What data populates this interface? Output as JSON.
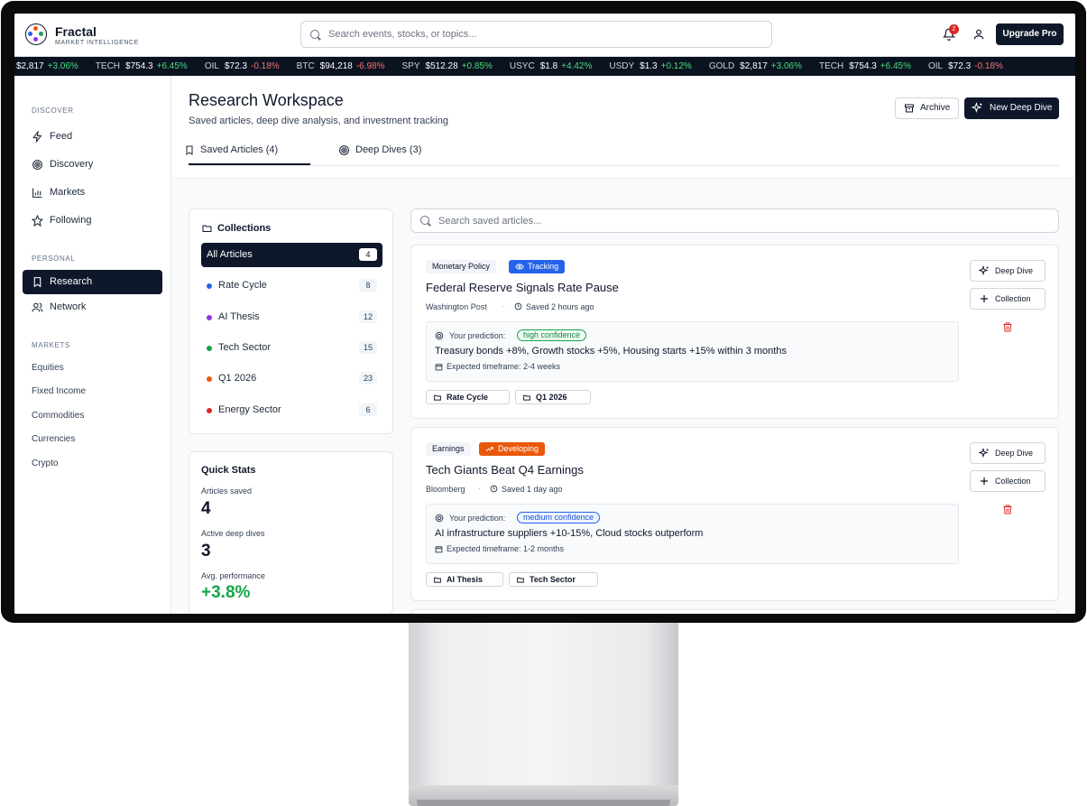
{
  "header": {
    "brand": "Fractal",
    "brand_sub": "MARKET INTELLIGENCE",
    "search_placeholder": "Search events, stocks, or topics...",
    "notification_count": "2",
    "upgrade_label": "Upgrade Pro"
  },
  "ticker": [
    {
      "symbol": "",
      "price": "$2,817",
      "change": "+3.06%",
      "dir": "up"
    },
    {
      "symbol": "TECH",
      "price": "$754.3",
      "change": "+6.45%",
      "dir": "up"
    },
    {
      "symbol": "OIL",
      "price": "$72.3",
      "change": "-0.18%",
      "dir": "down"
    },
    {
      "symbol": "BTC",
      "price": "$94,218",
      "change": "-6.98%",
      "dir": "down"
    },
    {
      "symbol": "SPY",
      "price": "$512.28",
      "change": "+0.85%",
      "dir": "up"
    },
    {
      "symbol": "USYC",
      "price": "$1.8",
      "change": "+4.42%",
      "dir": "up"
    },
    {
      "symbol": "USDY",
      "price": "$1.3",
      "change": "+0.12%",
      "dir": "up"
    },
    {
      "symbol": "GOLD",
      "price": "$2,817",
      "change": "+3.06%",
      "dir": "up"
    },
    {
      "symbol": "TECH",
      "price": "$754.3",
      "change": "+6.45%",
      "dir": "up"
    },
    {
      "symbol": "OIL",
      "price": "$72.3",
      "change": "-0.18%",
      "dir": "down"
    }
  ],
  "sidebar": {
    "discover_label": "DISCOVER",
    "discover": [
      {
        "label": "Feed",
        "icon": "zap-icon"
      },
      {
        "label": "Discovery",
        "icon": "target-icon"
      },
      {
        "label": "Markets",
        "icon": "bar-chart-icon"
      },
      {
        "label": "Following",
        "icon": "star-icon"
      }
    ],
    "personal_label": "PERSONAL",
    "personal": [
      {
        "label": "Research",
        "icon": "bookmark-icon",
        "active": true
      },
      {
        "label": "Network",
        "icon": "users-icon"
      }
    ],
    "markets_label": "MARKETS",
    "markets": [
      "Equities",
      "Fixed Income",
      "Commodities",
      "Currencies",
      "Crypto"
    ]
  },
  "workspace": {
    "title": "Research Workspace",
    "subtitle": "Saved articles, deep dive analysis, and investment tracking",
    "archive_label": "Archive",
    "new_deep_dive_label": "New Deep Dive",
    "tabs": [
      {
        "label": "Saved Articles (4)",
        "active": true
      },
      {
        "label": "Deep Dives (3)",
        "active": false
      }
    ]
  },
  "collections": {
    "title": "Collections",
    "items": [
      {
        "label": "All Articles",
        "count": "4",
        "color": "",
        "active": true
      },
      {
        "label": "Rate Cycle",
        "count": "8",
        "color": "#2563eb"
      },
      {
        "label": "AI Thesis",
        "count": "12",
        "color": "#9333ea"
      },
      {
        "label": "Tech Sector",
        "count": "15",
        "color": "#16a34a"
      },
      {
        "label": "Q1 2026",
        "count": "23",
        "color": "#ea580c"
      },
      {
        "label": "Energy Sector",
        "count": "6",
        "color": "#dc2626"
      }
    ]
  },
  "quick_stats": {
    "title": "Quick Stats",
    "articles_saved_label": "Articles saved",
    "articles_saved": "4",
    "deep_dives_label": "Active deep dives",
    "deep_dives": "3",
    "performance_label": "Avg. performance",
    "performance": "+3.8%"
  },
  "articles": {
    "search_placeholder": "Search saved articles...",
    "prediction_label": "Your prediction:",
    "deep_dive_label": "Deep Dive",
    "collection_label": "Collection",
    "items": [
      {
        "category": "Monetary Policy",
        "status": "Tracking",
        "title": "Federal Reserve Signals Rate Pause",
        "source": "Washington Post",
        "saved": "Saved 2 hours ago",
        "confidence": "high confidence",
        "prediction": "Treasury bonds +8%, Growth stocks +5%, Housing starts +15% within 3 months",
        "timeframe": "Expected timeframe: 2-4 weeks",
        "collections": [
          "Rate Cycle",
          "Q1 2026"
        ]
      },
      {
        "category": "Earnings",
        "status": "Developing",
        "title": "Tech Giants Beat Q4 Earnings",
        "source": "Bloomberg",
        "saved": "Saved 1 day ago",
        "confidence": "medium confidence",
        "prediction": "AI infrastructure suppliers +10-15%, Cloud stocks outperform",
        "timeframe": "Expected timeframe: 1-2 months",
        "collections": [
          "AI Thesis",
          "Tech Sector"
        ]
      }
    ]
  }
}
